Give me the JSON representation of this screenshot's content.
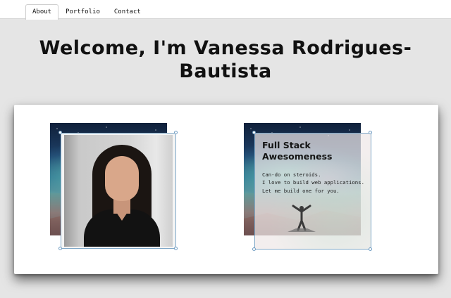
{
  "nav": {
    "tabs": [
      {
        "label": "About",
        "active": true
      },
      {
        "label": "Portfolio",
        "active": false
      },
      {
        "label": "Contact",
        "active": false
      }
    ]
  },
  "heading": {
    "line1": "Welcome, I'm Vanessa Rodrigues-",
    "line2": "Bautista"
  },
  "about": {
    "title_line1": "Full Stack",
    "title_line2": "Awesomeness",
    "lines": [
      "Can-do on steroids.",
      "I love to build web applications.",
      "Let me build one for you."
    ]
  },
  "colors": {
    "page_background": "#e5e5e5",
    "card_background": "#ffffff",
    "selection_border": "#7fa8c8"
  }
}
